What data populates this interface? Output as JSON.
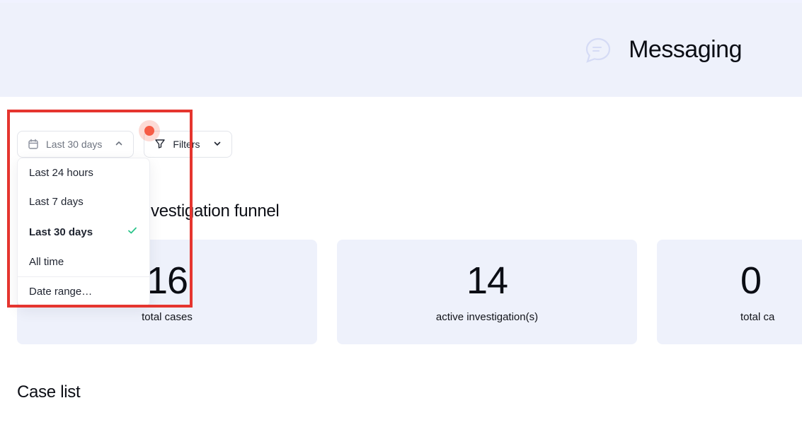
{
  "header": {
    "title": "Messaging"
  },
  "dateFilter": {
    "label": "Last 30 days",
    "options": [
      {
        "label": "Last 24 hours",
        "selected": false
      },
      {
        "label": "Last 7 days",
        "selected": false
      },
      {
        "label": "Last 30 days",
        "selected": true
      },
      {
        "label": "All time",
        "selected": false
      }
    ],
    "customOption": "Date range…"
  },
  "filters": {
    "label": "Filters"
  },
  "funnel": {
    "title": "nvestigation funnel",
    "cards": [
      {
        "value": "16",
        "label": "total cases"
      },
      {
        "value": "14",
        "label": "active investigation(s)"
      },
      {
        "value": "0",
        "label": "total ca"
      }
    ]
  },
  "caseList": {
    "title": "Case list"
  }
}
